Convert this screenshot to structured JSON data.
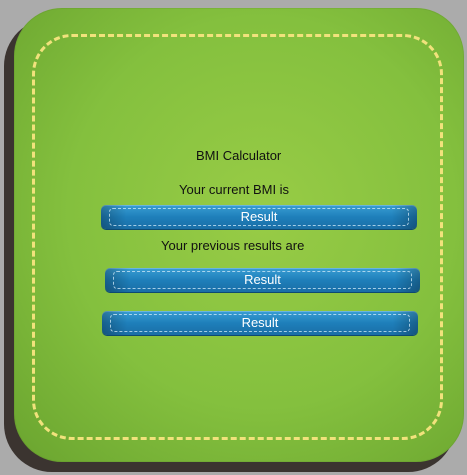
{
  "app": {
    "title": "BMI Calculator"
  },
  "current": {
    "label": "Your current BMI is",
    "result": "Result"
  },
  "previous": {
    "label": "Your previous results are",
    "results": [
      "Result",
      "Result"
    ]
  },
  "colors": {
    "card_green": "#8cc43f",
    "card_shadow": "#3b3430",
    "dashed_border": "#f1e27c",
    "result_blue": "#1e7fba",
    "background": "#ababab"
  }
}
